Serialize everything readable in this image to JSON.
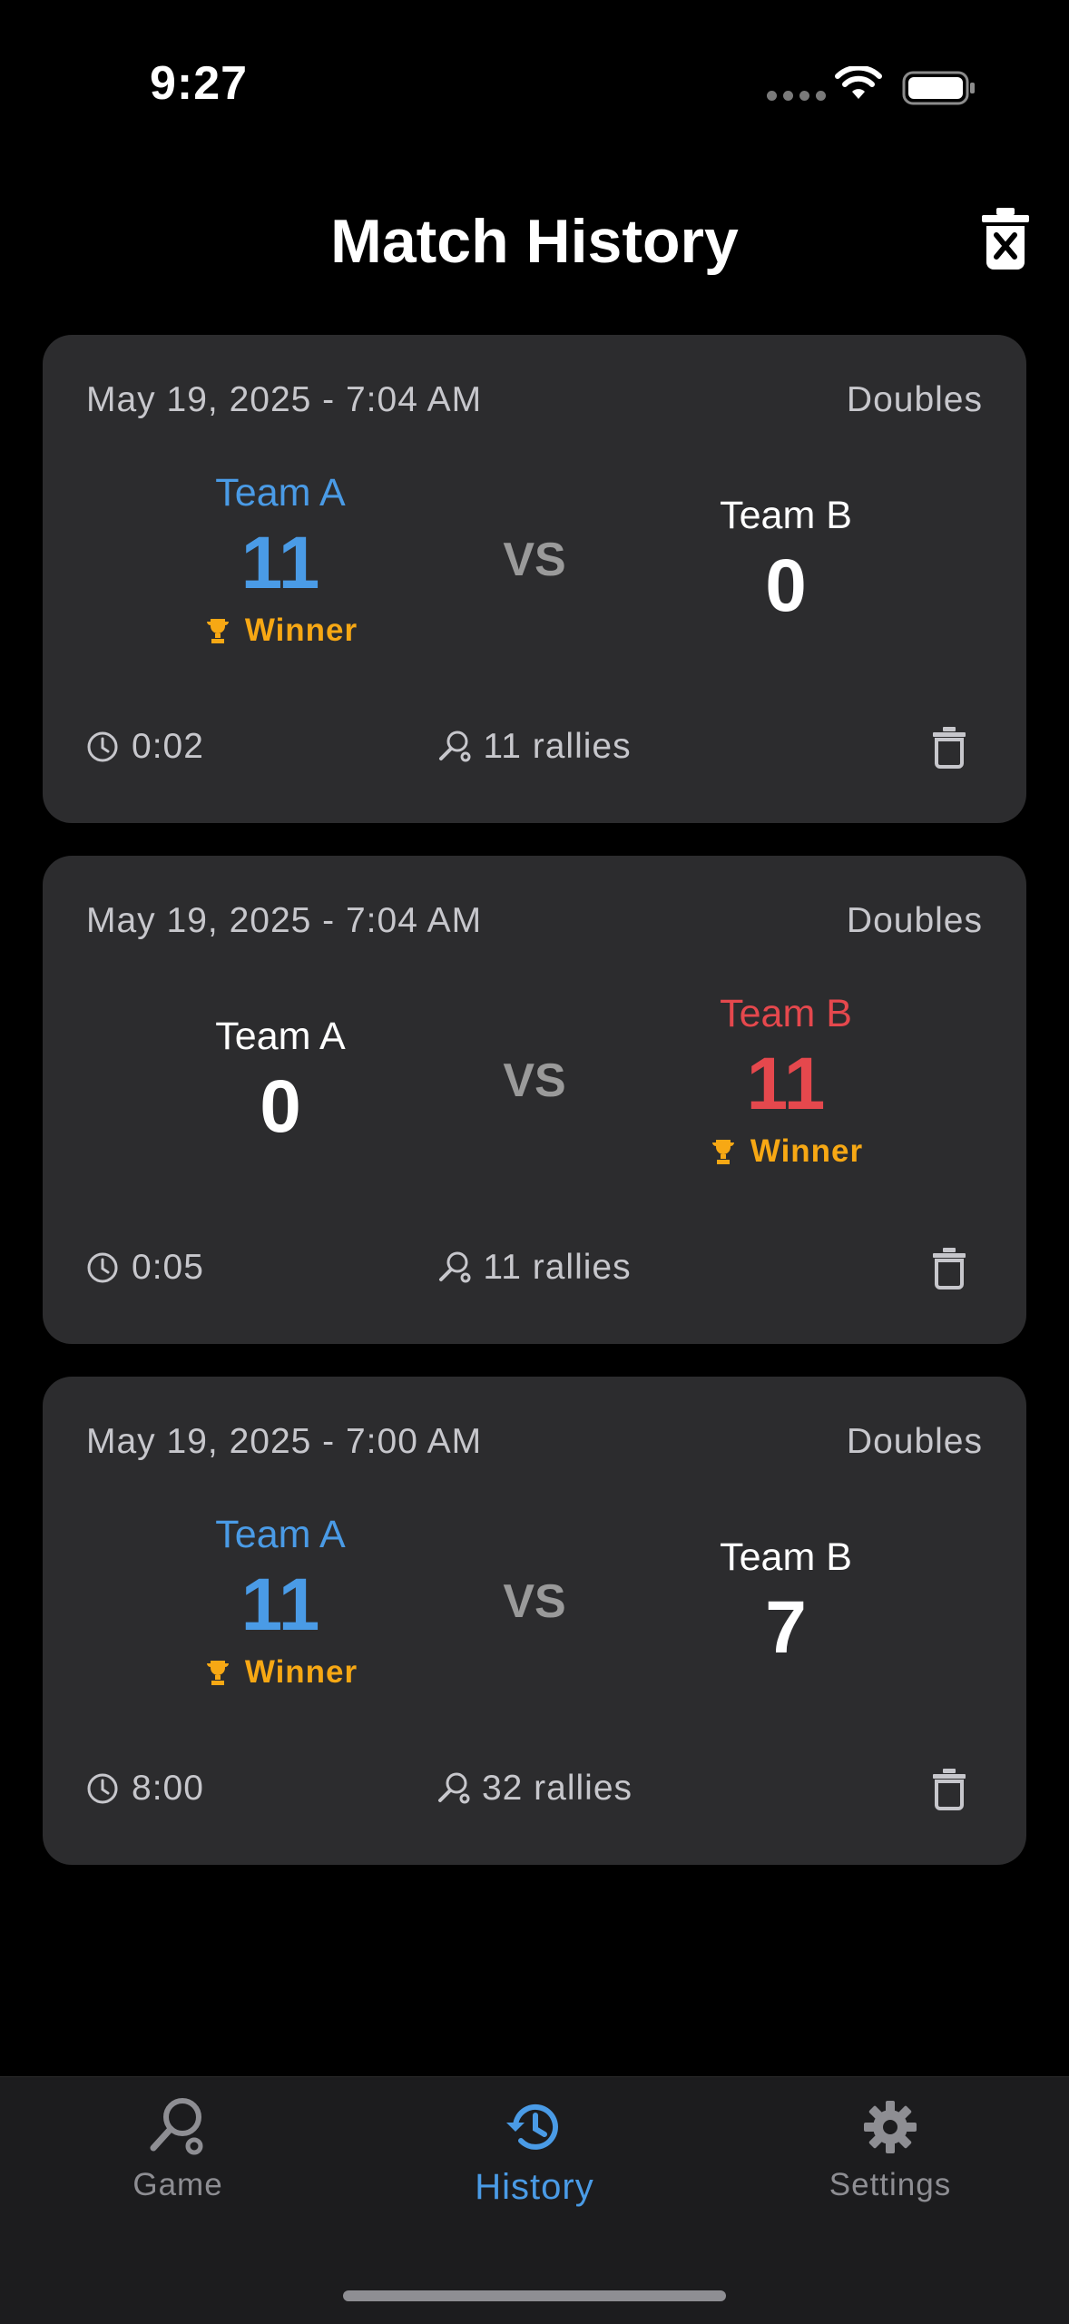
{
  "status_bar": {
    "time": "9:27"
  },
  "header": {
    "title": "Match History"
  },
  "colors": {
    "accent_blue": "#4a9be6",
    "team_b_red": "#e5484d",
    "winner_gold": "#f7a814",
    "card_bg": "#2c2c2e"
  },
  "matches": [
    {
      "date": "May 19, 2025 - 7:04 AM",
      "mode": "Doubles",
      "team_a": {
        "name": "Team A",
        "score": "11"
      },
      "team_b": {
        "name": "Team B",
        "score": "0"
      },
      "vs": "VS",
      "winner_label": "Winner",
      "winner": "team_a",
      "duration": "0:02",
      "rallies": "11 rallies"
    },
    {
      "date": "May 19, 2025 - 7:04 AM",
      "mode": "Doubles",
      "team_a": {
        "name": "Team A",
        "score": "0"
      },
      "team_b": {
        "name": "Team B",
        "score": "11"
      },
      "vs": "VS",
      "winner_label": "Winner",
      "winner": "team_b",
      "duration": "0:05",
      "rallies": "11 rallies"
    },
    {
      "date": "May 19, 2025 - 7:00 AM",
      "mode": "Doubles",
      "team_a": {
        "name": "Team A",
        "score": "11"
      },
      "team_b": {
        "name": "Team B",
        "score": "7"
      },
      "vs": "VS",
      "winner_label": "Winner",
      "winner": "team_a",
      "duration": "8:00",
      "rallies": "32 rallies"
    }
  ],
  "tabs": [
    {
      "label": "Game",
      "icon": "racket-icon",
      "active": false
    },
    {
      "label": "History",
      "icon": "history-icon",
      "active": true
    },
    {
      "label": "Settings",
      "icon": "gear-icon",
      "active": false
    }
  ]
}
